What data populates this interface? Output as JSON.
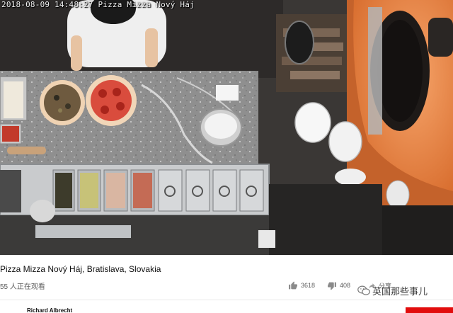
{
  "video": {
    "timestamp_overlay": "2018-08-09 14:48:27 Pizza Mizza Nový Háj"
  },
  "info": {
    "title": "Pizza Mizza Nový Háj, Bratislava, Slovakia",
    "viewers": "55 人正在观看",
    "like_count": "3618",
    "dislike_count": "408",
    "share_label": "分享",
    "watermark": "英国那些事儿",
    "channel_name": "Richard Albrecht"
  },
  "icons": {
    "like": "thumbs-up-icon",
    "dislike": "thumbs-down-icon",
    "share": "share-icon",
    "watermark": "wechat-icon"
  },
  "colors": {
    "subscribe": "#e20d0d",
    "oven_orange": "#e8874a",
    "counter_granite": "#9a9a9a"
  }
}
